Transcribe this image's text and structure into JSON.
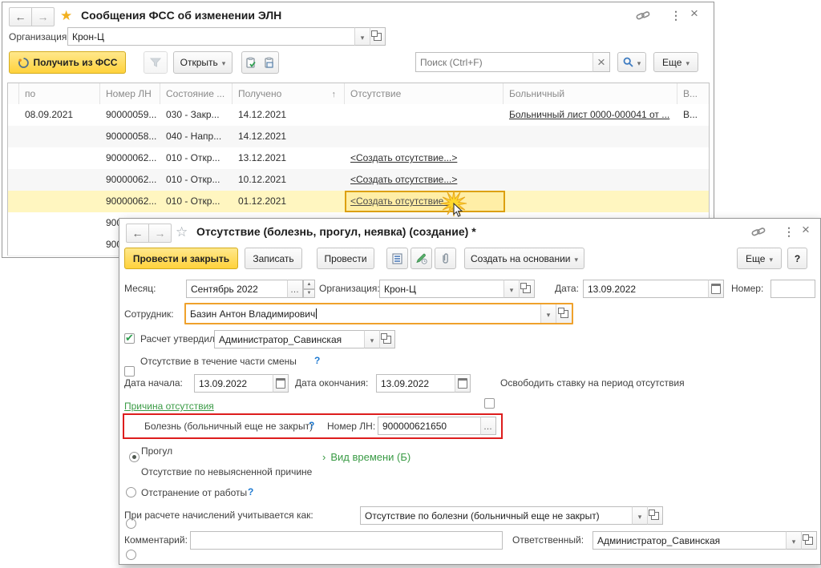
{
  "fss": {
    "title": "Сообщения ФСС об изменении ЭЛН",
    "org_label": "Организация:",
    "org_value": "Крон-Ц",
    "toolbar": {
      "get": "Получить из ФСС",
      "open": "Открыть",
      "search_placeholder": "Поиск (Ctrl+F)",
      "more": "Еще"
    },
    "columns": {
      "c1": "по",
      "c2": "Номер ЛН",
      "c3": "Состояние ...",
      "c4": "Получено",
      "c5": "Отсутствие",
      "c6": "Больничный",
      "c7": "В..."
    },
    "rows": [
      {
        "po": "08.09.2021",
        "num": "90000059...",
        "state": "030 - Закр...",
        "rec": "14.12.2021",
        "abs": "",
        "sick": "Больничный лист 0000-000041 от ...",
        "v": "В..."
      },
      {
        "po": "",
        "num": "90000058...",
        "state": "040 - Напр...",
        "rec": "14.12.2021",
        "abs": "",
        "sick": "",
        "v": ""
      },
      {
        "po": "",
        "num": "90000062...",
        "state": "010 - Откр...",
        "rec": "13.12.2021",
        "abs": "<Создать отсутствие...>",
        "sick": "",
        "v": ""
      },
      {
        "po": "",
        "num": "90000062...",
        "state": "010 - Откр...",
        "rec": "10.12.2021",
        "abs": "<Создать отсутствие...>",
        "sick": "",
        "v": ""
      },
      {
        "po": "",
        "num": "90000062...",
        "state": "010 - Откр...",
        "rec": "01.12.2021",
        "abs": "<Создать отсутствие...>",
        "sick": "",
        "v": ""
      },
      {
        "po": "",
        "num": "900",
        "state": "",
        "rec": "",
        "abs": "",
        "sick": "",
        "v": ""
      },
      {
        "po": "",
        "num": "900",
        "state": "",
        "rec": "",
        "abs": "",
        "sick": "",
        "v": ""
      }
    ]
  },
  "dlg": {
    "title": "Отсутствие (болезнь, прогул, неявка) (создание) *",
    "bar": {
      "post_close": "Провести и закрыть",
      "write": "Записать",
      "post": "Провести",
      "create_from": "Создать на основании",
      "more": "Еще",
      "help": "?"
    },
    "month_label": "Месяц:",
    "month_value": "Сентябрь 2022",
    "org_label": "Организация:",
    "org_value": "Крон-Ц",
    "date_label": "Дата:",
    "date_value": "13.09.2022",
    "num_label": "Номер:",
    "num_value": "",
    "emp_label": "Сотрудник:",
    "emp_value": "Базин Антон Владимирович",
    "approved_label": "Расчет утвердил",
    "approved_value": "Администратор_Савинская",
    "partshift_label": "Отсутствие в течение части смены",
    "start_label": "Дата начала:",
    "start_value": "13.09.2022",
    "end_label": "Дата окончания:",
    "end_value": "13.09.2022",
    "release_label": "Освободить ставку на период отсутствия",
    "section": "Причина отсутствия",
    "r1": "Болезнь (больничный еще не закрыт)",
    "ln_label": "Номер ЛН:",
    "ln_value": "900000621650",
    "r2": "Прогул",
    "r3": "Отсутствие по невыясненной причине",
    "r4": "Отстранение от работы",
    "time_link": "Вид времени (Б)",
    "calc_label": "При расчете начислений учитывается как:",
    "calc_value": "Отсутствие по болезни (больничный еще не закрыт)",
    "comment_label": "Комментарий:",
    "comment_value": "",
    "resp_label": "Ответственный:",
    "resp_value": "Администратор_Савинская",
    "help_mark": "?"
  }
}
